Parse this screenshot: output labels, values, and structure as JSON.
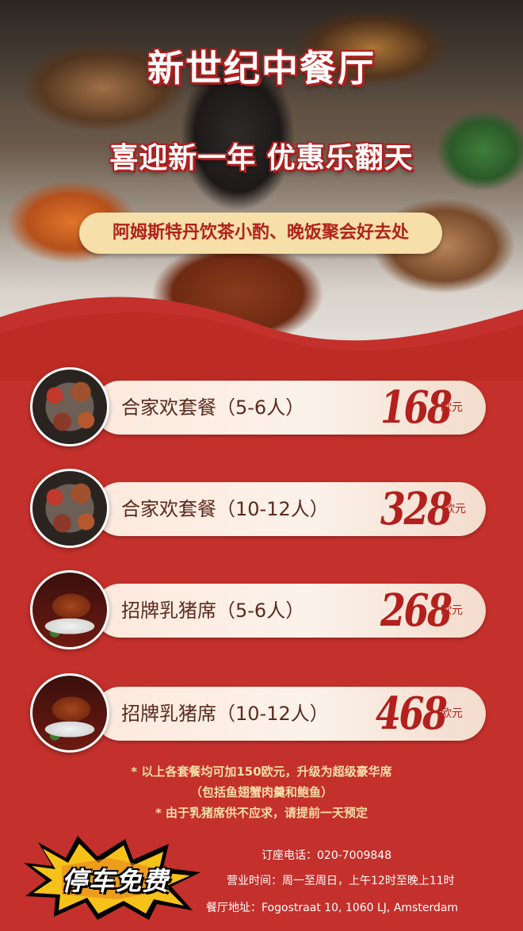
{
  "restaurant_name": "新世纪中餐厅",
  "headline": "喜迎新一年  优惠乐翻天",
  "tagline": "阿姆斯特丹饮茶小酌、晚饭聚会好去处",
  "menu": [
    {
      "name": "合家欢套餐（5-6人）",
      "price": "168",
      "unit": "欧元",
      "image": "family-platter"
    },
    {
      "name": "合家欢套餐（10-12人）",
      "price": "328",
      "unit": "欧元",
      "image": "family-platter"
    },
    {
      "name": "招牌乳猪席（5-6人）",
      "price": "268",
      "unit": "欧元",
      "image": "roast-suckling-pig"
    },
    {
      "name": "招牌乳猪席（10-12人）",
      "price": "468",
      "unit": "欧元",
      "image": "roast-suckling-pig"
    }
  ],
  "notes": [
    "* 以上各套餐均可加150欧元，升级为超级豪华席",
    "（包括鱼翅蟹肉羹和鲍鱼）",
    "* 由于乳猪席供不应求，请提前一天预定"
  ],
  "parking_badge": "停车免费",
  "contact": {
    "phone": "订座电话：020-7009848",
    "hours": "营业时间：周一至周日，上午12时至晚上11时",
    "address": "餐厅地址：Fogostraat 10, 1060 LJ, Amsterdam"
  },
  "colors": {
    "background": "#c4302b",
    "accent": "#f6dfa8",
    "price": "#b3201d"
  }
}
